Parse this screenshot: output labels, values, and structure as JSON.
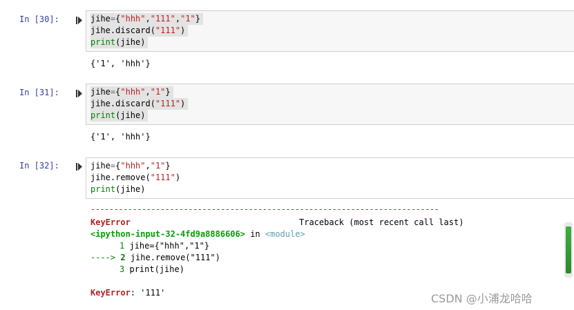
{
  "cells": [
    {
      "prompt": "In  [30]:",
      "lines": [
        [
          {
            "t": "jihe",
            "c": ""
          },
          {
            "t": "=",
            "c": "o"
          },
          {
            "t": "{",
            "c": ""
          },
          {
            "t": "\"hhh\"",
            "c": "s"
          },
          {
            "t": ",",
            "c": ""
          },
          {
            "t": "\"111\"",
            "c": "s"
          },
          {
            "t": ",",
            "c": ""
          },
          {
            "t": "\"1\"",
            "c": "s"
          },
          {
            "t": "}",
            "c": ""
          }
        ],
        [
          {
            "t": "jihe.discard(",
            "c": ""
          },
          {
            "t": "\"111\"",
            "c": "s"
          },
          {
            "t": ")",
            "c": ""
          }
        ],
        [
          {
            "t": "print",
            "c": "b"
          },
          {
            "t": "(jihe)",
            "c": ""
          }
        ]
      ],
      "output": [
        "{'1', 'hhh'}"
      ]
    },
    {
      "prompt": "In  [31]:",
      "lines": [
        [
          {
            "t": "jihe",
            "c": ""
          },
          {
            "t": "=",
            "c": "o"
          },
          {
            "t": "{",
            "c": ""
          },
          {
            "t": "\"hhh\"",
            "c": "s"
          },
          {
            "t": ",",
            "c": ""
          },
          {
            "t": "\"1\"",
            "c": "s"
          },
          {
            "t": "}",
            "c": ""
          }
        ],
        [
          {
            "t": "jihe.discard(",
            "c": ""
          },
          {
            "t": "\"111\"",
            "c": "s"
          },
          {
            "t": ")",
            "c": ""
          }
        ],
        [
          {
            "t": "print",
            "c": "b"
          },
          {
            "t": "(jihe)",
            "c": ""
          }
        ]
      ],
      "output": [
        "{'1', 'hhh'}"
      ]
    },
    {
      "prompt": "In  [32]:",
      "lines": [
        [
          {
            "t": "jihe",
            "c": ""
          },
          {
            "t": "=",
            "c": "o"
          },
          {
            "t": "{",
            "c": ""
          },
          {
            "t": "\"hhh\"",
            "c": "s"
          },
          {
            "t": ",",
            "c": ""
          },
          {
            "t": "\"1\"",
            "c": "s"
          },
          {
            "t": "}",
            "c": ""
          }
        ],
        [
          {
            "t": "jihe.remove(",
            "c": ""
          },
          {
            "t": "\"111\"",
            "c": "s"
          },
          {
            "t": ")",
            "c": ""
          }
        ],
        [
          {
            "t": "print",
            "c": "b"
          },
          {
            "t": "(jihe)",
            "c": ""
          }
        ]
      ]
    }
  ],
  "traceback": {
    "separator": "---------------------------------------------------------------------------",
    "error_name": "KeyError",
    "traceback_label": "Traceback (most recent call last)",
    "input_ref": "<ipython-input-32-4fd9a8886606>",
    "in_word": " in ",
    "module_ref": "<module>",
    "line1_no": "1",
    "line1_code": "jihe={\"hhh\",\"1\"}",
    "arrow": "---->",
    "line2_no": "2",
    "line2_code": "jihe.remove(\"111\")",
    "line3_no": "3",
    "line3_code": "print(jihe)",
    "final_error": "KeyError",
    "final_msg": ": '111'"
  },
  "watermark": "CSDN @小浦龙哈哈"
}
